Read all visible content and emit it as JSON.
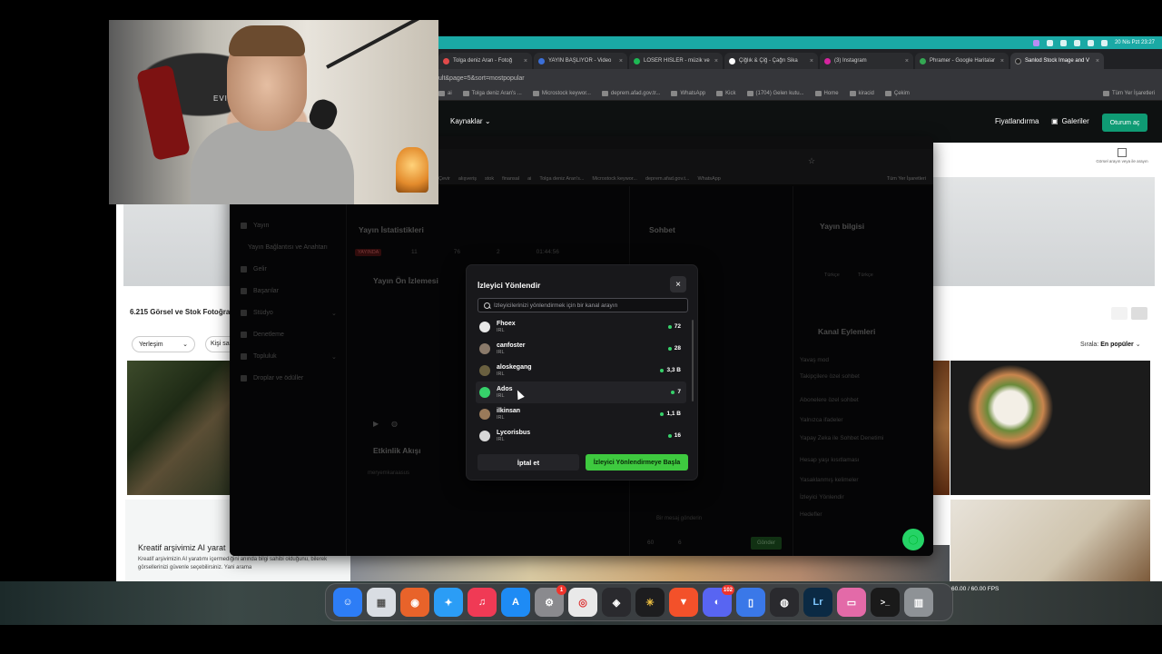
{
  "menubar": {
    "datetime": "20 Nis Pzt 23:27"
  },
  "outer_browser": {
    "tabs": [
      {
        "label": "Tolga deniz Aran - Fotoğ",
        "color": "#e24a4a"
      },
      {
        "label": "YAYIN BAŞLIYOR - Video",
        "color": "#3b6fd8"
      },
      {
        "label": "LOSER HISLER - müzik ve",
        "color": "#1db954"
      },
      {
        "label": "Çiğlık & Çiğ - Çağrı Sika",
        "color": "#ffffff"
      },
      {
        "label": "(3) Instagram",
        "color": "#d6249f"
      },
      {
        "label": "Phramer - Google Haritalar",
        "color": "#34a853"
      },
      {
        "label": "Sanlod Stock Image and V",
        "color": "#222222"
      }
    ],
    "url": "ult&page=5&sort=mostpopular",
    "bookmarks": [
      "ai",
      "Tolga deniz Aran's ...",
      "Microstock keywor...",
      "deprem.afad.gov.tr...",
      "WhatsApp",
      "Kick",
      "(1704) Gelen kutu...",
      "Home",
      "kiracid",
      "Çekim"
    ],
    "bookmarks_right": "Tüm Yer İşaretleri",
    "nav": {
      "sources": "Kaynaklar",
      "pricing": "Fiyatlandırma",
      "galleries": "Galeriler",
      "login": "Oturum aç"
    },
    "reverse_label": "Görsel arayın veya ile arayın",
    "results": "6.215 Görsel ve Stok Fotoğra",
    "layout_select": "Yerleşim",
    "person_select": "Kişi sa",
    "sort_label": "Sırala:",
    "sort_value": "En popüler",
    "card_title": "Kreatif arşivimiz AI yarat",
    "card_desc": "Kreatif arşivimizin AI yaratımı içermediğini anında bilgi sahibi olduğunu, bilerek görsellerinizi güvenle seçebilirsiniz. Yani arama"
  },
  "inner_browser": {
    "bookmarks": [
      "Çevir",
      "alışveriş",
      "stok",
      "finansal",
      "ai",
      "Tolga deniz Aran's...",
      "Microstock keywor...",
      "deprem.afad.gov.t...",
      "WhatsApp"
    ],
    "bookmarks_right": "Tüm Yer İşaretleri",
    "sidebar": {
      "items": [
        {
          "label": "Yayın"
        },
        {
          "label": "Yayın Bağlantısı ve Anahtarı"
        },
        {
          "label": "Gelir"
        },
        {
          "label": "Başarılar"
        },
        {
          "label": "Stüdyo"
        },
        {
          "label": "Denetleme"
        },
        {
          "label": "Topluluk"
        },
        {
          "label": "Droplar ve ödüller"
        }
      ]
    },
    "panels": {
      "stats": "Yayın İstatistikleri",
      "chat": "Sohbet",
      "info": "Yayın bilgisi",
      "preview": "Yayın Ön İzlemesi",
      "activity": "Etkinlik Akışı",
      "channel_actions": "Kanal Eylemleri"
    },
    "live_badge": "YAYINDA",
    "stats_values": [
      "11",
      "76",
      "2",
      "01:44:56"
    ],
    "channel_action_items": [
      "Yavaş mod",
      "Takipçilere özel sohbet",
      "Abonelere özel sohbet",
      "Yalnızca ifadeler",
      "Yapay Zeka ile Sohbet Denetimi",
      "Hesap yaşı kısıtlaması",
      "Yasaklanmış kelimeler",
      "İzleyici Yönlendir",
      "Hedefler"
    ],
    "info_tags": [
      "Türkçe",
      "Türkçe"
    ],
    "chat_send": "Gönder",
    "chat_placeholder": "Bir mesaj gönderin",
    "counts": [
      "60",
      "6"
    ],
    "activity_user": "meryemkaraasus"
  },
  "modal": {
    "title": "İzleyici Yönlendir",
    "search_placeholder": "İzleyicilerinizi yönlendirmek için bir kanal arayın",
    "channels": [
      {
        "name": "Fhoex",
        "category": "IRL",
        "viewers": "72",
        "avatar": "#e8e8e8"
      },
      {
        "name": "canfoster",
        "category": "IRL",
        "viewers": "28",
        "avatar": "#8a7a6a"
      },
      {
        "name": "aloskegang",
        "category": "IRL",
        "viewers": "3,3 B",
        "avatar": "#6a6040"
      },
      {
        "name": "Ados",
        "category": "IRL",
        "viewers": "7",
        "avatar": "#36d16a"
      },
      {
        "name": "ilkinsan",
        "category": "IRL",
        "viewers": "1,1 B",
        "avatar": "#9a7a5a"
      },
      {
        "name": "Lycorisbus",
        "category": "IRL",
        "viewers": "16",
        "avatar": "#d8d8d8"
      }
    ],
    "cancel": "İptal et",
    "start": "İzleyici Yönlendirmeye Başla"
  },
  "webcam": {
    "chair_brand": "EVISCE"
  },
  "dock": {
    "apps": [
      {
        "name": "finder",
        "color": "#2d7df6",
        "glyph": "☺"
      },
      {
        "name": "launchpad",
        "color": "#d9dde3",
        "glyph": "▦"
      },
      {
        "name": "firefox",
        "color": "#e8632a",
        "glyph": "◉"
      },
      {
        "name": "safari",
        "color": "#2b9df6",
        "glyph": "✦"
      },
      {
        "name": "music",
        "color": "#f03a55",
        "glyph": "♫"
      },
      {
        "name": "app-store",
        "color": "#1e8bf5",
        "glyph": "A"
      },
      {
        "name": "system-settings",
        "color": "#8a8a8e",
        "glyph": "⚙",
        "badge": "1"
      },
      {
        "name": "chrome",
        "color": "#e9e9e9",
        "glyph": "◎"
      },
      {
        "name": "davinci-resolve",
        "color": "#2a2a2e",
        "glyph": "◈"
      },
      {
        "name": "perplexity",
        "color": "#1d1d1f",
        "glyph": "✳"
      },
      {
        "name": "brave",
        "color": "#f3512a",
        "glyph": "▼"
      },
      {
        "name": "discord",
        "color": "#5865f2",
        "glyph": "◐",
        "badge": "102"
      },
      {
        "name": "preview",
        "color": "#3a78e8",
        "glyph": "▯"
      },
      {
        "name": "obs",
        "color": "#2a2a2e",
        "glyph": "◍"
      },
      {
        "name": "lightroom",
        "color": "#0b2a44",
        "glyph": "Lr"
      },
      {
        "name": "photo-booth",
        "color": "#e36aa8",
        "glyph": "▭"
      },
      {
        "name": "terminal",
        "color": "#1a1a1a",
        "glyph": ">_"
      },
      {
        "name": "trash",
        "color": "#8e9296",
        "glyph": "▥"
      }
    ],
    "fps": "60.00 / 60.00 FPS"
  }
}
